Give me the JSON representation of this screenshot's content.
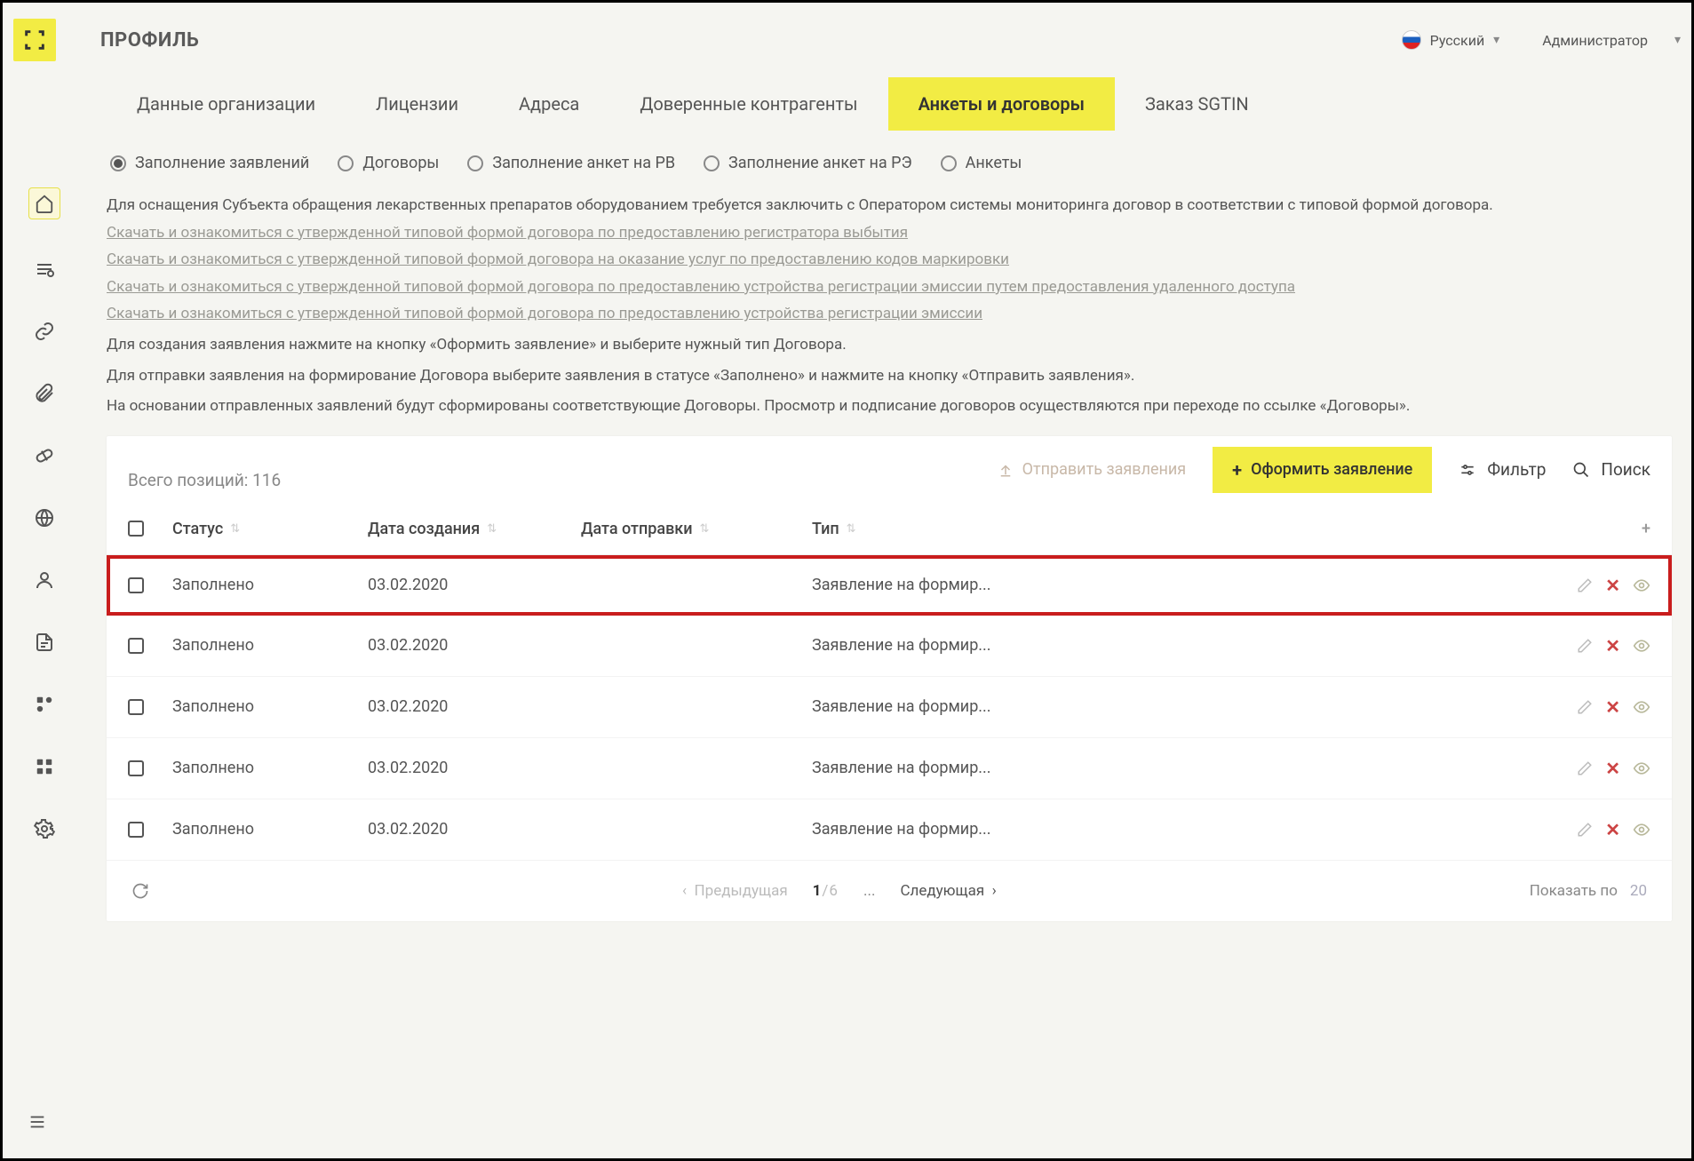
{
  "header": {
    "title": "ПРОФИЛЬ",
    "language": "Русский",
    "user": "Администратор"
  },
  "tabs": [
    {
      "label": "Данные организации"
    },
    {
      "label": "Лицензии"
    },
    {
      "label": "Адреса"
    },
    {
      "label": "Доверенные контрагенты"
    },
    {
      "label": "Анкеты и договоры",
      "active": true
    },
    {
      "label": "Заказ SGTIN"
    }
  ],
  "radios": [
    {
      "label": "Заполнение заявлений",
      "selected": true
    },
    {
      "label": "Договоры"
    },
    {
      "label": "Заполнение анкет на РВ"
    },
    {
      "label": "Заполнение анкет на РЭ"
    },
    {
      "label": "Анкеты"
    }
  ],
  "info": {
    "line1": "Для оснащения Субъекта обращения лекарственных препаратов оборудованием требуется заключить с Оператором системы мониторинга договор в соответствии с типовой формой договора.",
    "link1": "Скачать и ознакомиться с утвержденной типовой формой договора по предоставлению регистратора выбытия",
    "link2": "Скачать и ознакомиться с утвержденной типовой формой договора на оказание услуг по предоставлению кодов маркировки",
    "link3": "Скачать и ознакомиться с утвержденной типовой формой договора по предоставлению устройства регистрации эмиссии путем предоставления удаленного доступа",
    "link4": "Скачать и ознакомиться с утвержденной типовой формой договора по предоставлению устройства регистрации эмиссии",
    "line2": "Для создания заявления нажмите на кнопку «Оформить заявление» и выберите нужный тип Договора.",
    "line3": "Для отправки заявления на формирование Договора выберите заявления в статусе «Заполнено» и нажмите на кнопку «Отправить заявления».",
    "line4": "На основании отправленных заявлений будут сформированы соответствующие Договоры. Просмотр и подписание договоров осуществляются при переходе по ссылке «Договоры»."
  },
  "toolbar": {
    "total_label": "Всего позиций: 116",
    "send": "Отправить заявления",
    "create": "Оформить заявление",
    "filter": "Фильтр",
    "search": "Поиск"
  },
  "columns": {
    "status": "Статус",
    "created": "Дата создания",
    "sent": "Дата отправки",
    "type": "Тип"
  },
  "rows": [
    {
      "status": "Заполнено",
      "created": "03.02.2020",
      "sent": "",
      "type": "Заявление на формир...",
      "highlight": true
    },
    {
      "status": "Заполнено",
      "created": "03.02.2020",
      "sent": "",
      "type": "Заявление на формир..."
    },
    {
      "status": "Заполнено",
      "created": "03.02.2020",
      "sent": "",
      "type": "Заявление на формир..."
    },
    {
      "status": "Заполнено",
      "created": "03.02.2020",
      "sent": "",
      "type": "Заявление на формир..."
    },
    {
      "status": "Заполнено",
      "created": "03.02.2020",
      "sent": "",
      "type": "Заявление на формир..."
    }
  ],
  "pager": {
    "prev": "Предыдущая",
    "page": "1",
    "total_pages": "/6",
    "dots": "...",
    "next": "Следующая",
    "show": "Показать по",
    "per": "20"
  }
}
